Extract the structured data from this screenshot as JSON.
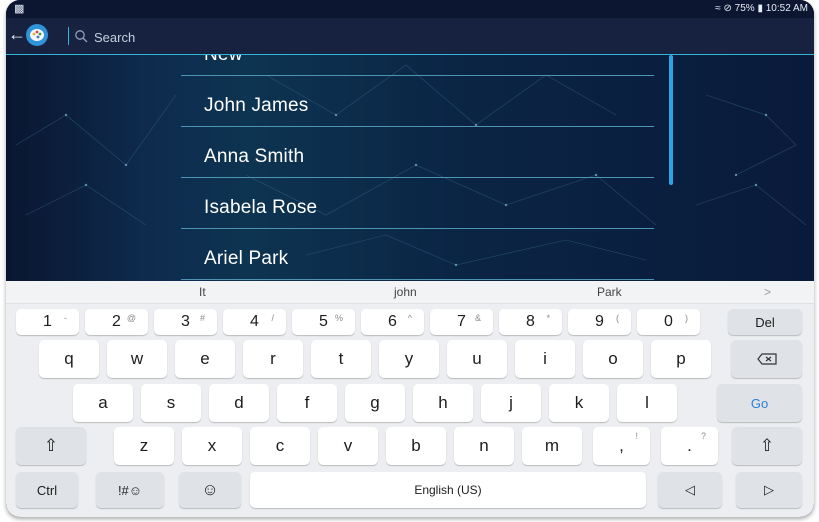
{
  "status": {
    "battery": "75%",
    "time": "10:52 AM"
  },
  "search": {
    "placeholder": "Search"
  },
  "contacts": [
    {
      "name": "New"
    },
    {
      "name": "John James"
    },
    {
      "name": "Anna Smith"
    },
    {
      "name": "Isabela Rose"
    },
    {
      "name": "Ariel Park"
    }
  ],
  "suggestions": [
    "It",
    "john",
    "Park",
    ">"
  ],
  "keyboard": {
    "number_row": [
      {
        "main": "1",
        "alt": "-"
      },
      {
        "main": "2",
        "alt": "@"
      },
      {
        "main": "3",
        "alt": "#"
      },
      {
        "main": "4",
        "alt": "/"
      },
      {
        "main": "5",
        "alt": "%"
      },
      {
        "main": "6",
        "alt": "^"
      },
      {
        "main": "7",
        "alt": "&"
      },
      {
        "main": "8",
        "alt": "*"
      },
      {
        "main": "9",
        "alt": "("
      },
      {
        "main": "0",
        "alt": ")"
      }
    ],
    "del": "Del",
    "row1": [
      "q",
      "w",
      "e",
      "r",
      "t",
      "y",
      "u",
      "i",
      "o",
      "p"
    ],
    "row2": [
      "a",
      "s",
      "d",
      "f",
      "g",
      "h",
      "j",
      "k",
      "l"
    ],
    "go": "Go",
    "row3": [
      "z",
      "x",
      "c",
      "v",
      "b",
      "n",
      "m"
    ],
    "comma": {
      "main": ",",
      "alt": "!"
    },
    "period": {
      "main": ".",
      "alt": "?"
    },
    "ctrl": "Ctrl",
    "symbols": "!#☺",
    "space": "English (US)",
    "go_color": "#2b7fd6"
  }
}
